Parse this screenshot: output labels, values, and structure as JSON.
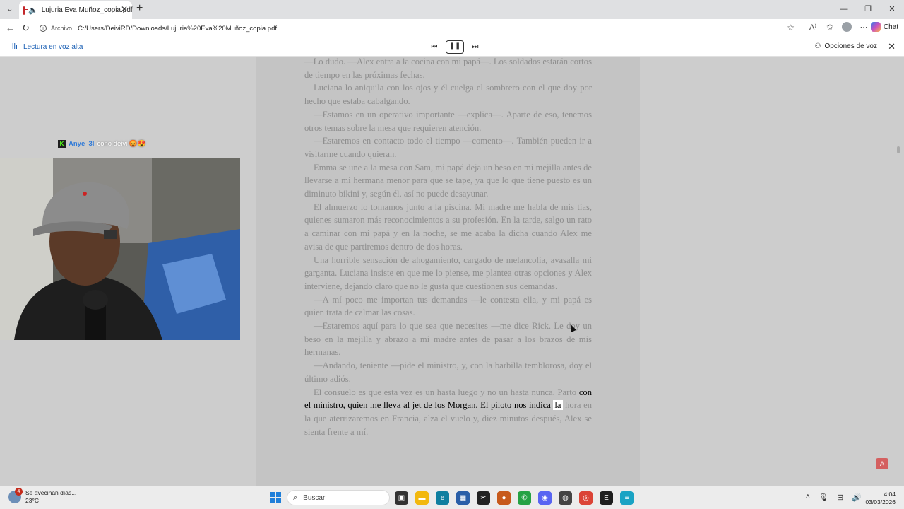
{
  "browser": {
    "tab_title": "Lujuria Eva Muñoz_copia.pdf",
    "tab_close": "✕",
    "new_tab": "+",
    "address_label": "Archivo",
    "address_url": "C:/Users/DeiviRD/Downloads/Lujuria%20Eva%20Muñoz_copia.pdf",
    "chat_label": "Chat"
  },
  "read_aloud": {
    "label": "Lectura en voz alta",
    "voice_options": "Opciones de voz"
  },
  "stream_chat": {
    "user": "Anye_3l",
    "message": "cono deivi 😡😍"
  },
  "document": {
    "paragraphs": [
      "—Lo dudo. —Alex entra a la cocina con mi papá—. Los soldados estarán cortos de tiempo en las próximas fechas.",
      "Luciana lo aniquila con los ojos y él cuelga el sombrero con el que doy por hecho que estaba cabalgando.",
      "—Estamos en un operativo importante —explica—. Aparte de eso, tenemos otros temas sobre la mesa que requieren atención.",
      "—Estaremos en contacto todo el tiempo —comento—. También pueden ir a visitarme cuando quieran.",
      "Emma se une a la mesa con Sam, mi papá deja un beso en mi mejilla antes de llevarse a mi hermana menor para que se tape, ya que lo que tiene puesto es un diminuto bikini y, según él, así no puede desayunar.",
      "El almuerzo lo tomamos junto a la piscina. Mi madre me habla de mis tías, quienes sumaron más reconocimientos a su profesión. En la tarde, salgo un rato a caminar con mi papá y en la noche, se me acaba la dicha cuando Alex me avisa de que partiremos dentro de dos horas.",
      "Una horrible sensación de ahogamiento, cargado de melancolía, avasalla mi garganta. Luciana insiste en que me lo piense, me plantea otras opciones y Alex interviene, dejando claro que no le gusta que cuestionen sus demandas.",
      "—A mí poco me importan tus demandas —le contesta ella, y mi papá es quien trata de calmar las cosas.",
      "—Estaremos aquí para lo que sea que necesites —me dice Rick. Le doy un beso en la mejilla y abrazo a mi madre antes de pasar a los brazos de mis hermanas.",
      "—Andando, teniente —pide el ministro, y, con la barbilla temblorosa, doy el último adiós."
    ],
    "last_para_start": "El consuelo es que esta vez es un hasta luego y no un hasta nunca. Parto ",
    "last_para_highlight": "con el ministro, quien me lleva al jet de los Morgan. El piloto nos indica ",
    "last_para_word": "la",
    "last_para_end": " hora en la que aterrizaremos en Francia, alza el vuelo y, diez minutos después, Alex se sienta frente a mí."
  },
  "taskbar": {
    "weather_title": "Se avecinan días...",
    "weather_temp": "23°C",
    "weather_badge": "4",
    "search_placeholder": "Buscar",
    "time": "4:04",
    "date": "03/03/2026"
  }
}
